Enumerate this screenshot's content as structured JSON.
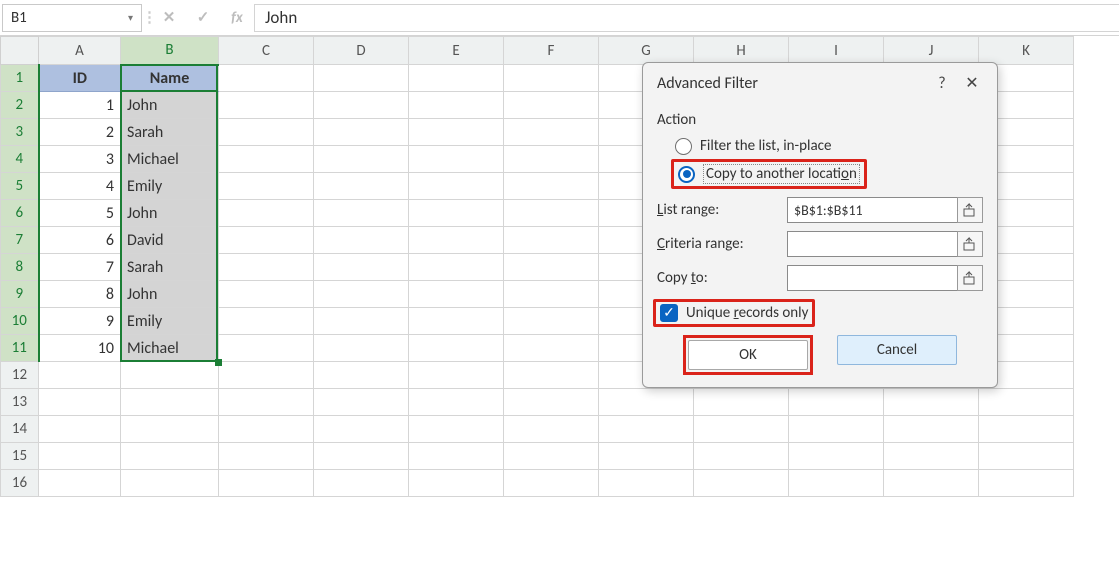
{
  "formula_bar": {
    "name_box": "B1",
    "value": "John"
  },
  "columns": [
    "A",
    "B",
    "C",
    "D",
    "E",
    "F",
    "G",
    "H",
    "I",
    "J",
    "K"
  ],
  "col_widths": {
    "A": 82,
    "B": 98,
    "C": 95,
    "D": 95,
    "E": 95,
    "F": 95,
    "G": 95,
    "H": 95,
    "I": 95,
    "J": 95,
    "K": 95
  },
  "active_cell_hidden_behind": true,
  "table": {
    "headers": {
      "A": "ID",
      "B": "Name"
    },
    "rows": [
      {
        "A": "1",
        "B": "John"
      },
      {
        "A": "2",
        "B": "Sarah"
      },
      {
        "A": "3",
        "B": "Michael"
      },
      {
        "A": "4",
        "B": "Emily"
      },
      {
        "A": "5",
        "B": "John"
      },
      {
        "A": "6",
        "B": "David"
      },
      {
        "A": "7",
        "B": "Sarah"
      },
      {
        "A": "8",
        "B": "John"
      },
      {
        "A": "9",
        "B": "Emily"
      },
      {
        "A": "10",
        "B": "Michael"
      }
    ]
  },
  "row_count": 16,
  "selected_column": "B",
  "selection_range": "B1:B11",
  "dialog": {
    "title": "Advanced Filter",
    "action_label": "Action",
    "radio_inplace": "Filter the list, in-place",
    "radio_copy": "Copy to another location",
    "radio_selected": "copy",
    "list_range_label": "List range:",
    "list_range_value": "$B$1:$B$11",
    "criteria_label": "Criteria range:",
    "criteria_value": "",
    "copyto_label": "Copy to:",
    "copyto_value": "",
    "unique_label": "Unique records only",
    "unique_checked": true,
    "ok_label": "OK",
    "cancel_label": "Cancel"
  }
}
